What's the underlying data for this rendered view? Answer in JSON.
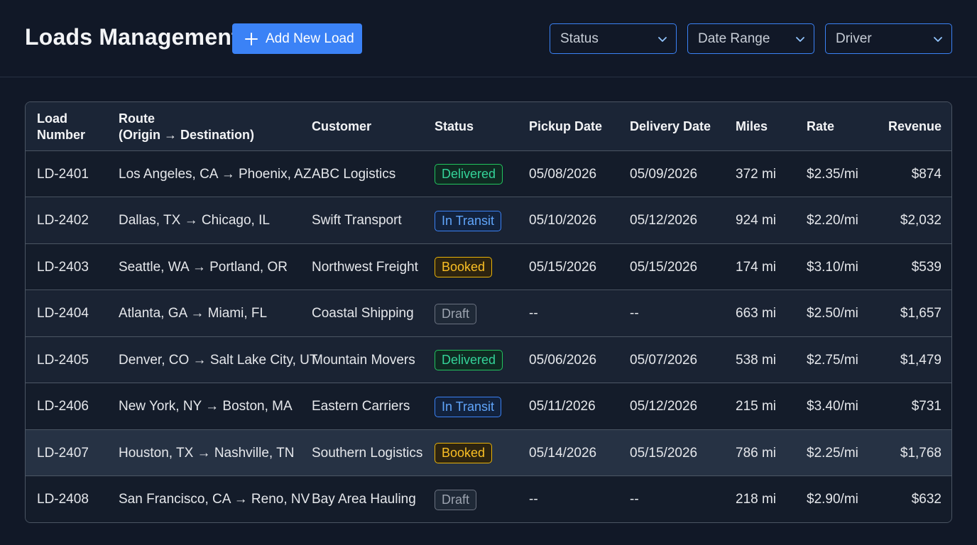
{
  "header": {
    "title": "Loads Management",
    "add_button": "Add New Load",
    "filters": [
      {
        "label": "Status"
      },
      {
        "label": "Date Range"
      },
      {
        "label": "Driver"
      }
    ]
  },
  "table": {
    "columns": {
      "load_line1": "Load",
      "load_line2": "Number",
      "route_line1": "Route",
      "route_line2": "(Origin → Destination)",
      "customer": "Customer",
      "status": "Status",
      "pickup": "Pickup Date",
      "delivery": "Delivery Date",
      "miles": "Miles",
      "rate": "Rate",
      "revenue": "Revenue"
    },
    "rows": [
      {
        "load": "LD-2401",
        "route": "Los Angeles, CA → Phoenix, AZ",
        "customer": "ABC Logistics",
        "status": "Delivered",
        "pickup": "05/08/2026",
        "delivery": "05/09/2026",
        "miles": "372 mi",
        "rate": "$2.35/mi",
        "revenue": "$874"
      },
      {
        "load": "LD-2402",
        "route": "Dallas, TX → Chicago, IL",
        "customer": "Swift Transport",
        "status": "In Transit",
        "pickup": "05/10/2026",
        "delivery": "05/12/2026",
        "miles": "924 mi",
        "rate": "$2.20/mi",
        "revenue": "$2,032"
      },
      {
        "load": "LD-2403",
        "route": "Seattle, WA → Portland, OR",
        "customer": "Northwest Freight",
        "status": "Booked",
        "pickup": "05/15/2026",
        "delivery": "05/15/2026",
        "miles": "174 mi",
        "rate": "$3.10/mi",
        "revenue": "$539"
      },
      {
        "load": "LD-2404",
        "route": "Atlanta, GA → Miami, FL",
        "customer": "Coastal Shipping",
        "status": "Draft",
        "pickup": "--",
        "delivery": "--",
        "miles": "663 mi",
        "rate": "$2.50/mi",
        "revenue": "$1,657"
      },
      {
        "load": "LD-2405",
        "route": "Denver, CO → Salt Lake City, UT",
        "customer": "Mountain Movers",
        "status": "Delivered",
        "pickup": "05/06/2026",
        "delivery": "05/07/2026",
        "miles": "538 mi",
        "rate": "$2.75/mi",
        "revenue": "$1,479"
      },
      {
        "load": "LD-2406",
        "route": "New York, NY → Boston, MA",
        "customer": "Eastern Carriers",
        "status": "In Transit",
        "pickup": "05/11/2026",
        "delivery": "05/12/2026",
        "miles": "215 mi",
        "rate": "$3.40/mi",
        "revenue": "$731"
      },
      {
        "load": "LD-2407",
        "route": "Houston, TX → Nashville, TN",
        "customer": "Southern Logistics",
        "status": "Booked",
        "pickup": "05/14/2026",
        "delivery": "05/15/2026",
        "miles": "786 mi",
        "rate": "$2.25/mi",
        "revenue": "$1,768"
      },
      {
        "load": "LD-2408",
        "route": "San Francisco, CA → Reno, NV",
        "customer": "Bay Area Hauling",
        "status": "Draft",
        "pickup": "--",
        "delivery": "--",
        "miles": "218 mi",
        "rate": "$2.90/mi",
        "revenue": "$632"
      }
    ]
  },
  "colors": {
    "background": "#111827",
    "accent": "#3b82f6",
    "delivered": "#22c55e",
    "in_transit": "#3b82f6",
    "booked": "#eab308",
    "draft": "#6b7280"
  },
  "icons": {
    "add": "plus-icon",
    "dropdown": "chevron-down-icon"
  }
}
